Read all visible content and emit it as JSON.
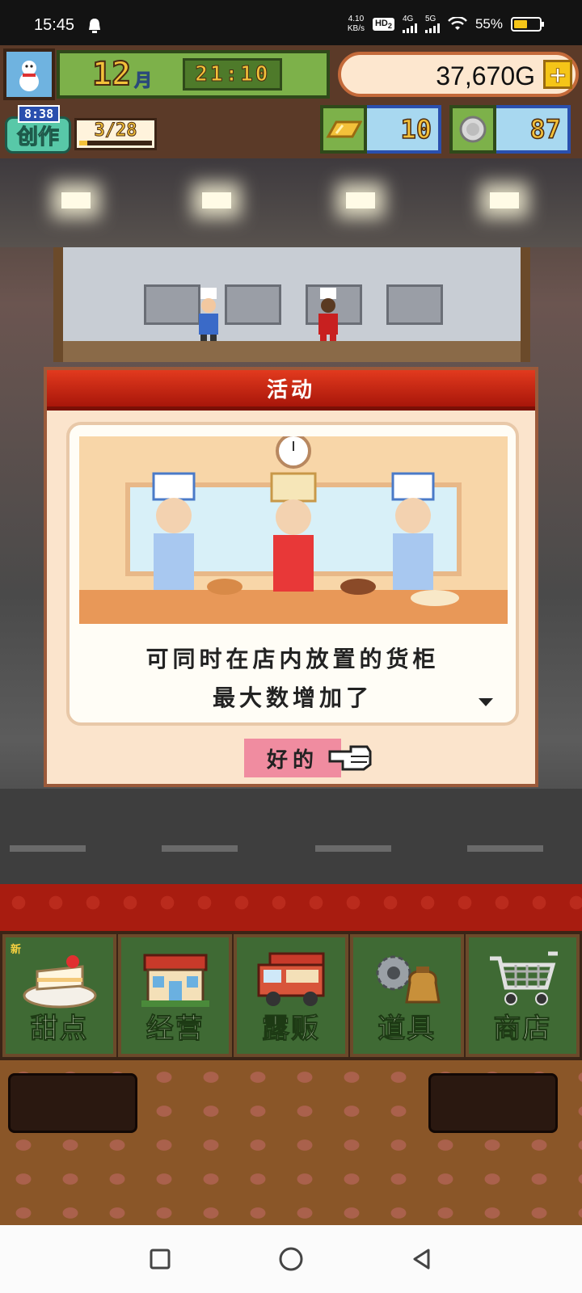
{
  "status_bar": {
    "time": "15:45",
    "net_speed_value": "4.10",
    "net_speed_unit": "KB/s",
    "hd_label": "HD",
    "hd_sub": "2",
    "sig1_label": "4G",
    "sig2_label": "5G",
    "battery_percent": "55%",
    "battery_level": 0.55
  },
  "hud": {
    "month_number": "12",
    "month_label": "月",
    "clock": "21:10",
    "gold": "37,670G",
    "plus_label": "+",
    "create_timer": "8:38",
    "create_label": "创作",
    "create_count": "3/28",
    "create_progress": 0.11,
    "gold_bars": "10",
    "medals": "87"
  },
  "dialog": {
    "title": "活动",
    "message_line1": "可同时在店内放置的货柜",
    "message_line2": "最大数增加了",
    "ok_label": "好的"
  },
  "menu": {
    "new_badge": "新",
    "items": [
      {
        "label": "甜点",
        "icon": "cake-icon"
      },
      {
        "label": "经营",
        "icon": "shop-building-icon"
      },
      {
        "label": "露贩",
        "icon": "food-truck-icon"
      },
      {
        "label": "道具",
        "icon": "gear-bag-icon"
      },
      {
        "label": "商店",
        "icon": "cart-icon"
      }
    ]
  },
  "colors": {
    "header_red": "#c8200e",
    "dialog_bg": "#fbe4cc",
    "menu_green": "#3f6a34",
    "gold_text": "#f3c13a",
    "ok_pink": "#f08ca0"
  }
}
